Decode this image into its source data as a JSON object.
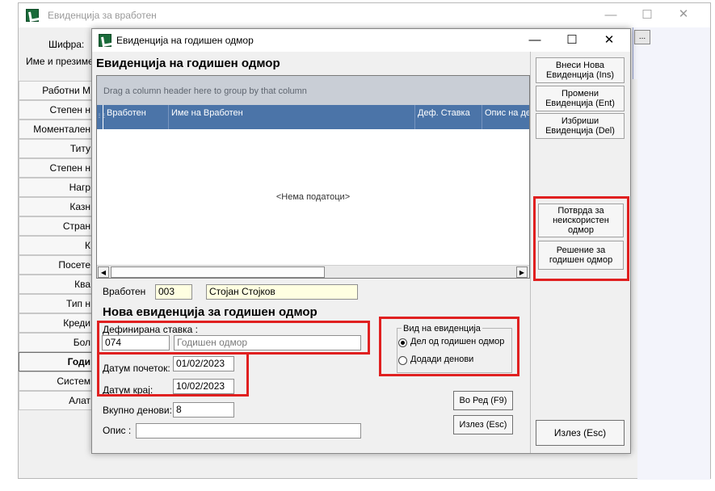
{
  "parent": {
    "title": "Евиденција за вработен",
    "shifra_label": "Шифра:",
    "ime_label": "Име и презиме:",
    "top_right_btn": "...",
    "side_tabs": [
      "Работни М",
      "Степен н",
      "Моментален",
      "Титу",
      "Степен н",
      "Нагр",
      "Казн",
      "Стран",
      "К",
      "Посете",
      "Ква",
      "Тип н",
      "Креди",
      "Бол",
      "Годи",
      "Систем",
      "Алат"
    ]
  },
  "dialog": {
    "title": "Евиденција на годишен одмор",
    "header": "Евиденција на годишен одмор",
    "grid": {
      "group_hint": "Drag a column header here to group by that column",
      "columns": [
        "Вработен",
        "Име на Вработен",
        "Деф. Ставка",
        "Опис на де"
      ],
      "empty_text": "<Нема податоци>"
    },
    "employee": {
      "label": "Вработен",
      "code": "003",
      "name": "Стојан  Стојков"
    },
    "new_header": "Нова евиденција за годишен одмор",
    "defined_item": {
      "label": "Дефинирана ставка :",
      "code": "074",
      "name": "Годишен одмор"
    },
    "date_start": {
      "label": "Датум почеток:",
      "value": "01/02/2023"
    },
    "date_end": {
      "label": "Датум крај:",
      "value": "10/02/2023"
    },
    "total_days": {
      "label": "Вкупно денови:",
      "value": "8"
    },
    "description": {
      "label": "Опис :",
      "value": ""
    },
    "evidence_type": {
      "caption": "Вид на евиденција",
      "option1": "Дел од годишен одмор",
      "option2": "Додади денови",
      "selected": "Дел од годишен одмор"
    },
    "buttons": {
      "ok": "Во Ред (F9)",
      "exit": "Излез (Esc)",
      "add_new": "Внеси Нова Евиденција (Ins)",
      "edit": "Промени Евиденција (Ent)",
      "delete": "Избриши Евиденција (Del)",
      "confirm_unused": "Потврда за неискористен одмор",
      "decision": "Решение за годишен одмор",
      "exit_right": "Излез (Esc)"
    }
  },
  "colors": {
    "grid_header": "#4b74a8",
    "group_panel": "#c9ced6",
    "highlight_red": "#e02020",
    "input_yellow": "#ffffe1"
  }
}
